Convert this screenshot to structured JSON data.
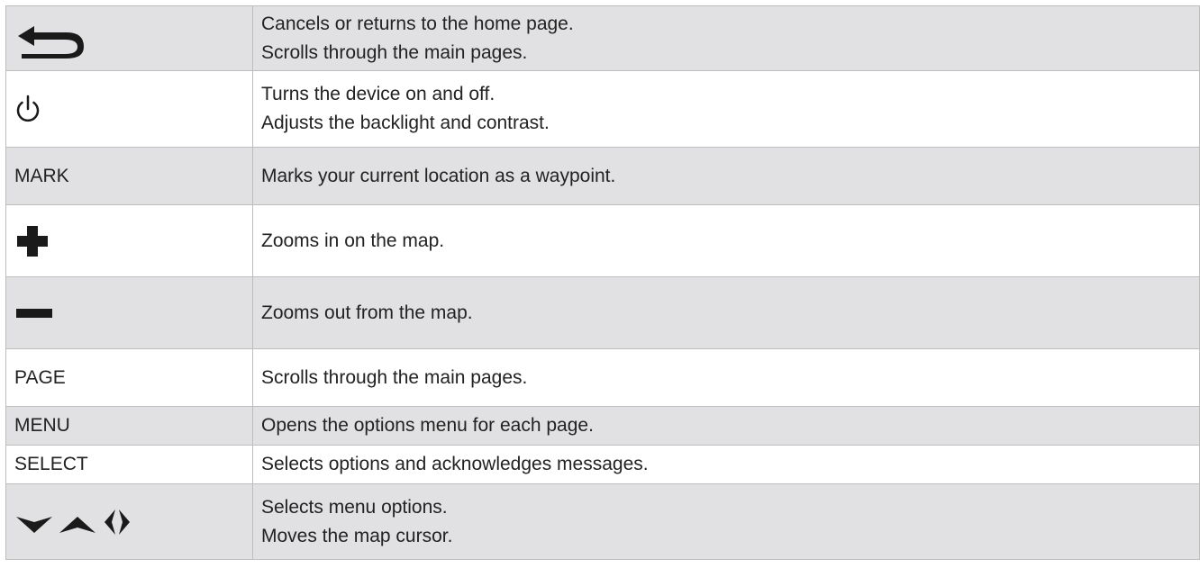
{
  "colors": {
    "shaded_row": "#e1e1e3",
    "plain_row": "#ffffff",
    "border": "#bdbdbd",
    "icon": "#1a1a1a"
  },
  "rows": [
    {
      "key_icon": "back-arrow-icon",
      "desc_lines": [
        "Cancels or returns to the home page.",
        "Scrolls through the main pages."
      ]
    },
    {
      "key_icon": "power-icon",
      "desc_lines": [
        "Turns the device on and off.",
        "Adjusts the backlight and contrast."
      ]
    },
    {
      "key_text": "MARK",
      "desc_lines": [
        "Marks your current location as a waypoint."
      ]
    },
    {
      "key_icon": "plus-icon",
      "desc_lines": [
        "Zooms in on the map."
      ]
    },
    {
      "key_icon": "minus-icon",
      "desc_lines": [
        "Zooms out from the map."
      ]
    },
    {
      "key_text": "PAGE",
      "desc_lines": [
        "Scrolls through the main pages."
      ]
    },
    {
      "key_text": "MENU",
      "desc_lines": [
        "Opens the options menu for each page."
      ]
    },
    {
      "key_text": "SELECT",
      "desc_lines": [
        "Selects options and acknowledges messages."
      ]
    },
    {
      "key_icon": "direction-arrows-icon",
      "desc_lines": [
        "Selects menu options.",
        "Moves the map cursor."
      ]
    }
  ]
}
